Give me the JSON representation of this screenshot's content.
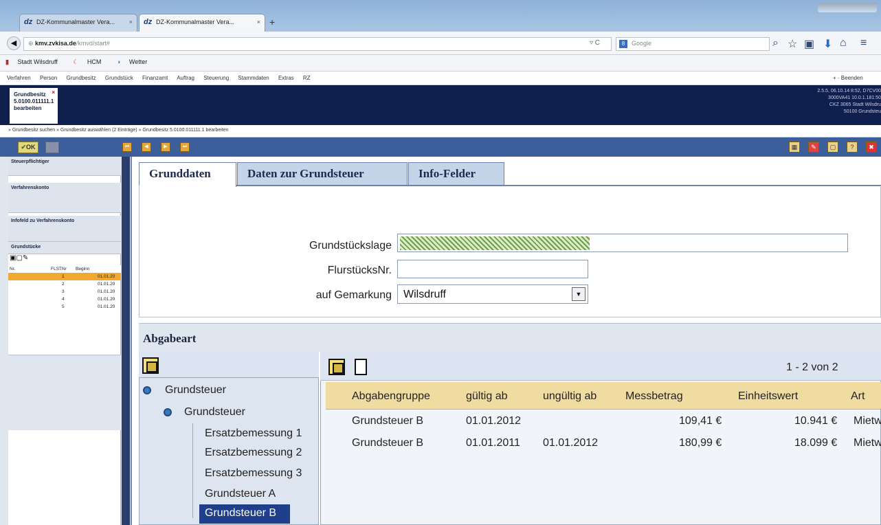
{
  "browser": {
    "tabs": [
      {
        "logo": "dz",
        "label": "DZ-Kommunalmaster Vera...",
        "close": "×"
      },
      {
        "logo": "dz",
        "label": "DZ-Kommunalmaster Vera...",
        "close": "×"
      }
    ],
    "new_tab": "+",
    "url_domain": "kmv.zvkisa.de",
    "url_path": "/kmvd/start#",
    "search_placeholder": "Google",
    "bookmarks": [
      "Stadt Wilsdruff",
      "HCM",
      "Wetter"
    ]
  },
  "app": {
    "menu": [
      "Verfahren",
      "Person",
      "Grundbesitz",
      "Grundstück",
      "Finanzamt",
      "Auftrag",
      "Steuerung",
      "Stammdaten",
      "Extras",
      "RZ"
    ],
    "menu_right": "+ · Beenden",
    "doc_tab": {
      "line1": "Grundbesitz",
      "line2": "5.0100.011111.1",
      "line3": "bearbeiten",
      "close": "×"
    },
    "info_lines": [
      "2.5.5, 06.10.14 8:52, D7CV00",
      "3000VA41 10.0.1.181:50",
      "CKZ 3065 Stadt Wilsdru",
      "50100 Grundsteu"
    ],
    "breadcrumb": "» Grundbesitz suchen  » Grundbesitz auswählen (2 Einträge)  » Grundbesitz 5.0100.011111.1 bearbeiten",
    "ok_label": "OK"
  },
  "left": {
    "sections": [
      "Steuerpflichtiger",
      "Verfahrenskonto",
      "Infofeld zu Verfahrenskonto",
      "Grundstücke"
    ],
    "grid_headers": [
      "Nr.",
      "FLSTNr",
      "Beginn"
    ],
    "rows": [
      {
        "nr": "1",
        "beginn": "01.01.20"
      },
      {
        "nr": "2",
        "beginn": "01.01.20"
      },
      {
        "nr": "3",
        "beginn": "01.01.20"
      },
      {
        "nr": "4",
        "beginn": "01.01.20"
      },
      {
        "nr": "5",
        "beginn": "01.01.20"
      }
    ]
  },
  "main": {
    "tabs": [
      "Grunddaten",
      "Daten zur Grundsteuer",
      "Info-Felder"
    ],
    "form": {
      "grundstueckslage_label": "Grundstückslage",
      "flurstuecksnr_label": "FlurstücksNr.",
      "gemarkung_label": "auf Gemarkung",
      "gemarkung_value": "Wilsdruff"
    },
    "abgabeart_title": "Abgabeart",
    "tree": [
      "Grundsteuer",
      "Grundsteuer",
      "Ersatzbemessung 1",
      "Ersatzbemessung 2",
      "Ersatzbemessung 3",
      "Grundsteuer A",
      "Grundsteuer B"
    ],
    "pager": "1 - 2 von 2",
    "grid_headers": [
      "Abgabengruppe",
      "gültig ab",
      "ungültig ab",
      "Messbetrag",
      "Einheitswert",
      "Art"
    ],
    "grid_rows": [
      {
        "gruppe": "Grundsteuer B",
        "gueltig": "01.01.2012",
        "ungueltig": "",
        "mess": "109,41 €",
        "einheit": "10.941 €",
        "art": "Mietw"
      },
      {
        "gruppe": "Grundsteuer B",
        "gueltig": "01.01.2011",
        "ungueltig": "01.01.2012",
        "mess": "180,99 €",
        "einheit": "18.099 €",
        "art": "Mietw"
      }
    ]
  }
}
